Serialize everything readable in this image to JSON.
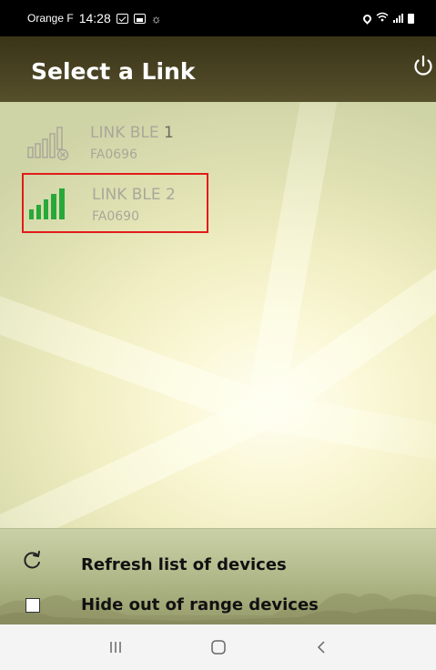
{
  "status_bar": {
    "carrier": "Orange F",
    "time": "14:28",
    "icons": [
      "message-icon",
      "gallery-icon",
      "brightness-icon",
      "location-icon",
      "wifi-icon",
      "signal-icon",
      "battery-icon"
    ]
  },
  "app_bar": {
    "title": "Select a Link",
    "power_icon": "power-icon"
  },
  "devices": [
    {
      "name": "LINK BLE",
      "number": "1",
      "code": "FA0696",
      "signal": "out-of-range",
      "selected": false
    },
    {
      "name": "LINK BLE",
      "number": "2",
      "code": "FA0690",
      "signal": "full",
      "selected": true
    }
  ],
  "footer": {
    "refresh_label": "Refresh list of devices",
    "hide_label": "Hide out of range devices",
    "hide_checked": false
  },
  "colors": {
    "signal_green": "#27a93a",
    "selection_border": "#e21b1b",
    "app_bar": "#4a4424"
  },
  "nav_bar": {
    "buttons": [
      "recent-apps-icon",
      "home-icon",
      "back-icon"
    ]
  }
}
